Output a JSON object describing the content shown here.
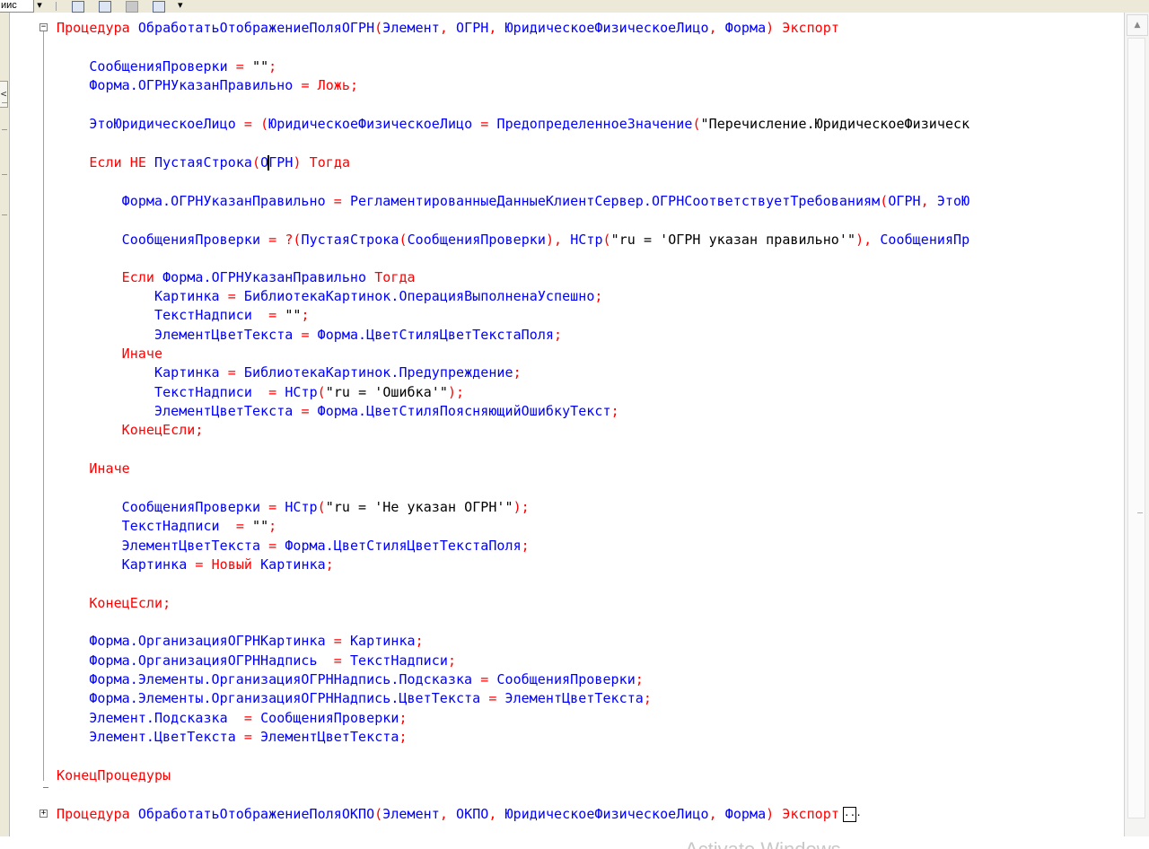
{
  "toolbar": {
    "combo_text": "иис",
    "combo_arrow": "▾",
    "more_arrow": "▾",
    "icons": [
      "new-module-icon",
      "copy-module-icon",
      "settings-icon",
      "list-icon"
    ]
  },
  "left_panel": {
    "tab_glyph": "<"
  },
  "code": {
    "l1": {
      "kw1": "Процедура",
      "name": "ОбработатьОтображениеПоляОГРН",
      "p1": "Элемент",
      "p2": "ОГРН",
      "p3": "ЮридическоеФизическоеЛицо",
      "p4": "Форма",
      "kw2": "Экспорт"
    },
    "l2": {
      "a": "СообщенияПроверки",
      "b": "\"\""
    },
    "l3": {
      "a": "Форма.ОГРНУказанПравильно",
      "kw": "Ложь"
    },
    "l4": {
      "a": "ЭтоЮридическоеЛицо",
      "b": "ЮридическоеФизическоеЛицо",
      "c": "ПредопределенноеЗначение",
      "s": "\"Перечисление.ЮридическоеФизическ"
    },
    "l5": {
      "kw1": "Если",
      "kw2": "НЕ",
      "fn": "ПустаяСтрока",
      "arg_a": "О",
      "arg_b": "ГРН",
      "kw3": "Тогда"
    },
    "l6": {
      "a": "Форма.ОГРНУказанПравильно",
      "b": "РегламентированныеДанныеКлиентСервер.ОГРНСоответствуетТребованиям",
      "c": "ОГРН",
      "d": "ЭтоЮ"
    },
    "l7": {
      "a": "СообщенияПроверки",
      "fn": "ПустаяСтрока",
      "b": "СообщенияПроверки",
      "c": "НСтр",
      "s": "\"ru = 'ОГРН указан правильно'\"",
      "d": "СообщенияПр"
    },
    "l8": {
      "kw1": "Если",
      "a": "Форма.ОГРНУказанПравильно",
      "kw2": "Тогда"
    },
    "l9": {
      "a": "Картинка",
      "b": "БиблиотекаКартинок.ОперацияВыполненаУспешно"
    },
    "l10": {
      "a": "ТекстНадписи",
      "s": "\"\""
    },
    "l11": {
      "a": "ЭлементЦветТекста",
      "b": "Форма.ЦветСтиляЦветТекстаПоля"
    },
    "l12": {
      "kw": "Иначе"
    },
    "l13": {
      "a": "Картинка",
      "b": "БиблиотекаКартинок.Предупреждение"
    },
    "l14": {
      "a": "ТекстНадписи",
      "b": "НСтр",
      "s": "\"ru = 'Ошибка'\""
    },
    "l15": {
      "a": "ЭлементЦветТекста",
      "b": "Форма.ЦветСтиляПоясняющийОшибкуТекст"
    },
    "l16": {
      "kw": "КонецЕсли"
    },
    "l17": {
      "kw": "Иначе"
    },
    "l18": {
      "a": "СообщенияПроверки",
      "b": "НСтр",
      "s": "\"ru = 'Не указан ОГРН'\""
    },
    "l19": {
      "a": "ТекстНадписи",
      "s": "\"\""
    },
    "l20": {
      "a": "ЭлементЦветТекста",
      "b": "Форма.ЦветСтиляЦветТекстаПоля"
    },
    "l21": {
      "a": "Картинка",
      "kw": "Новый",
      "b": "Картинка"
    },
    "l22": {
      "kw": "КонецЕсли"
    },
    "l23": {
      "a": "Форма.ОрганизацияОГРНКартинка",
      "b": "Картинка"
    },
    "l24": {
      "a": "Форма.ОрганизацияОГРННадпись",
      "b": "ТекстНадписи"
    },
    "l25": {
      "a": "Форма.Элементы.ОрганизацияОГРННадпись.Подсказка",
      "b": "СообщенияПроверки"
    },
    "l26": {
      "a": "Форма.Элементы.ОрганизацияОГРННадпись.ЦветТекста",
      "b": "ЭлементЦветТекста"
    },
    "l27": {
      "a": "Элемент.Подсказка",
      "b": "СообщенияПроверки"
    },
    "l28": {
      "a": "Элемент.ЦветТекста",
      "b": "ЭлементЦветТекста"
    },
    "l29": {
      "kw": "КонецПроцедуры"
    },
    "l30": {
      "kw1": "Процедура",
      "name": "ОбработатьОтображениеПоляОКПО",
      "p1": "Элемент",
      "p2": "ОКПО",
      "p3": "ЮридическоеФизическоеЛицо",
      "p4": "Форма",
      "kw2": "Экспорт",
      "collapsed": "..."
    }
  },
  "fold": {
    "collapse_glyph": "−",
    "expand_glyph": "+"
  },
  "scrollbar": {
    "up_glyph": "▲"
  },
  "watermark": "Activate Windows",
  "colors": {
    "keyword": "#ff0000",
    "identifier": "#0000ff",
    "string": "#000000",
    "background": "#ffffff"
  }
}
